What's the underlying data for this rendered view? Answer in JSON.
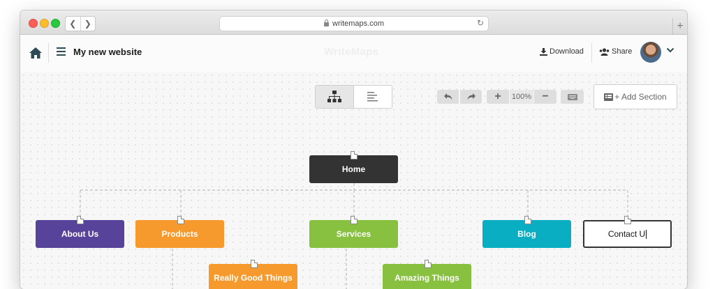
{
  "browser": {
    "url": "writemaps.com",
    "new_tab_label": "+"
  },
  "app": {
    "site_title": "My new website",
    "brand": "WriteMaps",
    "download_label": "Download",
    "share_label": "Share"
  },
  "toolbar": {
    "zoom": "100%",
    "add_section_label": "+ Add Section"
  },
  "sitemap": {
    "home": {
      "label": "Home",
      "color": "#333333"
    },
    "children": [
      {
        "label": "About Us",
        "color": "#574399"
      },
      {
        "label": "Products",
        "color": "#f79a2e"
      },
      {
        "label": "Services",
        "color": "#88c13f"
      },
      {
        "label": "Blog",
        "color": "#09aec3"
      },
      {
        "label": "Contact U",
        "color": "#ffffff"
      }
    ],
    "grandchildren": [
      {
        "label": "Really Good Things",
        "color": "#f79a2e"
      },
      {
        "label": "Amazing Things",
        "color": "#88c13f"
      }
    ]
  }
}
